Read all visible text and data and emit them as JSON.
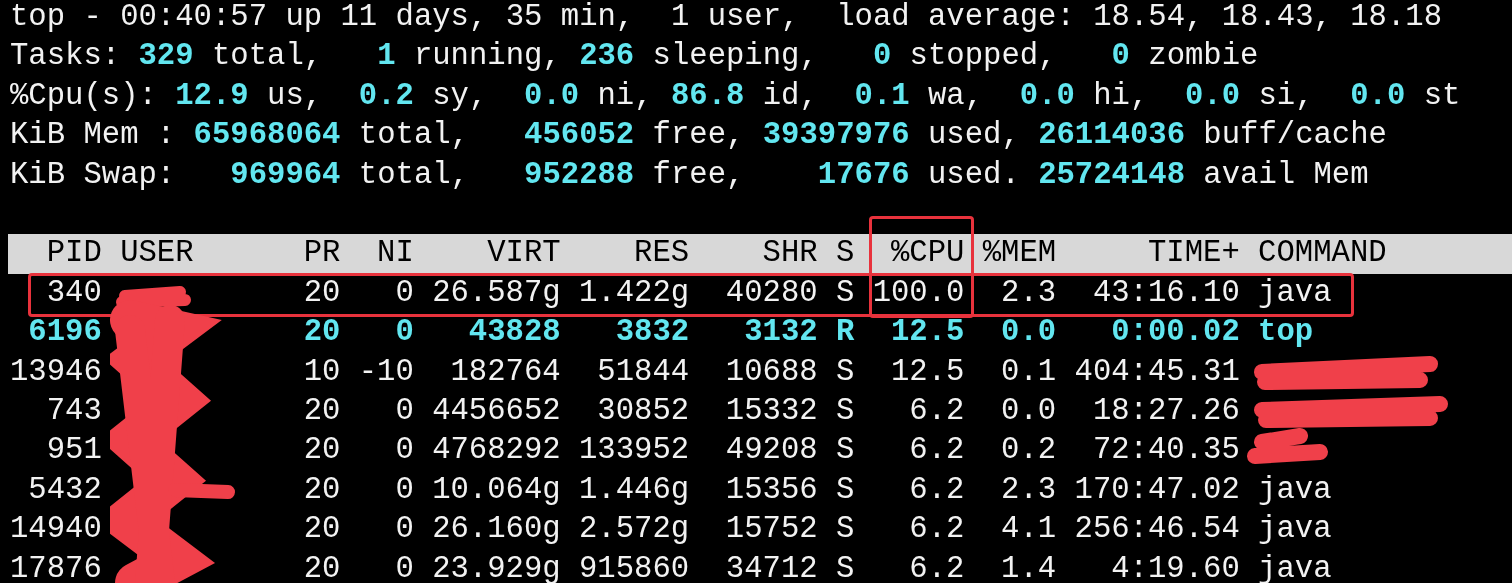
{
  "summary": [
    [
      {
        "text": "top - 00:40:57 up 11 days, 35 min,  1 user,  load average: 18.54, 18.43, 18.18",
        "kind": "label"
      }
    ],
    [
      {
        "text": "Tasks: ",
        "kind": "label"
      },
      {
        "text": "329",
        "kind": "value"
      },
      {
        "text": " total,   ",
        "kind": "label"
      },
      {
        "text": "1",
        "kind": "value"
      },
      {
        "text": " running, ",
        "kind": "label"
      },
      {
        "text": "236",
        "kind": "value"
      },
      {
        "text": " sleeping,   ",
        "kind": "label"
      },
      {
        "text": "0",
        "kind": "value"
      },
      {
        "text": " stopped,   ",
        "kind": "label"
      },
      {
        "text": "0",
        "kind": "value"
      },
      {
        "text": " zombie",
        "kind": "label"
      }
    ],
    [
      {
        "text": "%Cpu(s): ",
        "kind": "label"
      },
      {
        "text": "12.9",
        "kind": "value"
      },
      {
        "text": " us,  ",
        "kind": "label"
      },
      {
        "text": "0.2",
        "kind": "value"
      },
      {
        "text": " sy,  ",
        "kind": "label"
      },
      {
        "text": "0.0",
        "kind": "value"
      },
      {
        "text": " ni, ",
        "kind": "label"
      },
      {
        "text": "86.8",
        "kind": "value"
      },
      {
        "text": " id,  ",
        "kind": "label"
      },
      {
        "text": "0.1",
        "kind": "value"
      },
      {
        "text": " wa,  ",
        "kind": "label"
      },
      {
        "text": "0.0",
        "kind": "value"
      },
      {
        "text": " hi,  ",
        "kind": "label"
      },
      {
        "text": "0.0",
        "kind": "value"
      },
      {
        "text": " si,  ",
        "kind": "label"
      },
      {
        "text": "0.0",
        "kind": "value"
      },
      {
        "text": " st",
        "kind": "label"
      }
    ],
    [
      {
        "text": "KiB Mem : ",
        "kind": "label"
      },
      {
        "text": "65968064",
        "kind": "value"
      },
      {
        "text": " total,   ",
        "kind": "label"
      },
      {
        "text": "456052",
        "kind": "value"
      },
      {
        "text": " free, ",
        "kind": "label"
      },
      {
        "text": "39397976",
        "kind": "value"
      },
      {
        "text": " used, ",
        "kind": "label"
      },
      {
        "text": "26114036",
        "kind": "value"
      },
      {
        "text": " buff/cache",
        "kind": "label"
      }
    ],
    [
      {
        "text": "KiB Swap:   ",
        "kind": "label"
      },
      {
        "text": "969964",
        "kind": "value"
      },
      {
        "text": " total,   ",
        "kind": "label"
      },
      {
        "text": "952288",
        "kind": "value"
      },
      {
        "text": " free,    ",
        "kind": "label"
      },
      {
        "text": "17676",
        "kind": "value"
      },
      {
        "text": " used. ",
        "kind": "label"
      },
      {
        "text": "25724148",
        "kind": "value"
      },
      {
        "text": " avail Mem",
        "kind": "label"
      }
    ]
  ],
  "table": {
    "columns": [
      {
        "label": "PID",
        "outlined": false
      },
      {
        "label": "USER",
        "outlined": false
      },
      {
        "label": "PR",
        "outlined": false
      },
      {
        "label": "NI",
        "outlined": false
      },
      {
        "label": "VIRT",
        "outlined": false
      },
      {
        "label": "RES",
        "outlined": false
      },
      {
        "label": "SHR",
        "outlined": false
      },
      {
        "label": "S",
        "outlined": false
      },
      {
        "label": "%CPU",
        "outlined": true
      },
      {
        "label": "%MEM",
        "outlined": false
      },
      {
        "label": "TIME+",
        "outlined": false
      },
      {
        "label": "COMMAND",
        "outlined": false
      }
    ],
    "rows": [
      {
        "cells": [
          "340",
          null,
          "20",
          "0",
          "26.587g",
          "1.422g",
          "40280",
          "S",
          "100.0",
          "2.3",
          "43:16.10",
          "java"
        ],
        "bold": false,
        "outlined": true
      },
      {
        "cells": [
          "6196",
          null,
          "20",
          "0",
          "43828",
          "3832",
          "3132",
          "R",
          "12.5",
          "0.0",
          "0:00.02",
          "top"
        ],
        "bold": true,
        "outlined": false
      },
      {
        "cells": [
          "13946",
          null,
          "10",
          "-10",
          "182764",
          "51844",
          "10688",
          "S",
          "12.5",
          "0.1",
          "404:45.31",
          null
        ],
        "bold": false,
        "outlined": false
      },
      {
        "cells": [
          "743",
          null,
          "20",
          "0",
          "4456652",
          "30852",
          "15332",
          "S",
          "6.2",
          "0.0",
          "18:27.26",
          null
        ],
        "bold": false,
        "outlined": false
      },
      {
        "cells": [
          "951",
          null,
          "20",
          "0",
          "4768292",
          "133952",
          "49208",
          "S",
          "6.2",
          "0.2",
          "72:40.35",
          null
        ],
        "bold": false,
        "outlined": false
      },
      {
        "cells": [
          "5432",
          null,
          "20",
          "0",
          "10.064g",
          "1.446g",
          "15356",
          "S",
          "6.2",
          "2.3",
          "170:47.02",
          "java"
        ],
        "bold": false,
        "outlined": false
      },
      {
        "cells": [
          "14940",
          null,
          "20",
          "0",
          "26.160g",
          "2.572g",
          "15752",
          "S",
          "6.2",
          "4.1",
          "256:46.54",
          "java"
        ],
        "bold": false,
        "outlined": false
      },
      {
        "cells": [
          "17876",
          null,
          "20",
          "0",
          "23.929g",
          "915860",
          "34712",
          "S",
          "6.2",
          "1.4",
          "4:19.60",
          "java"
        ],
        "bold": false,
        "outlined": false
      }
    ]
  }
}
